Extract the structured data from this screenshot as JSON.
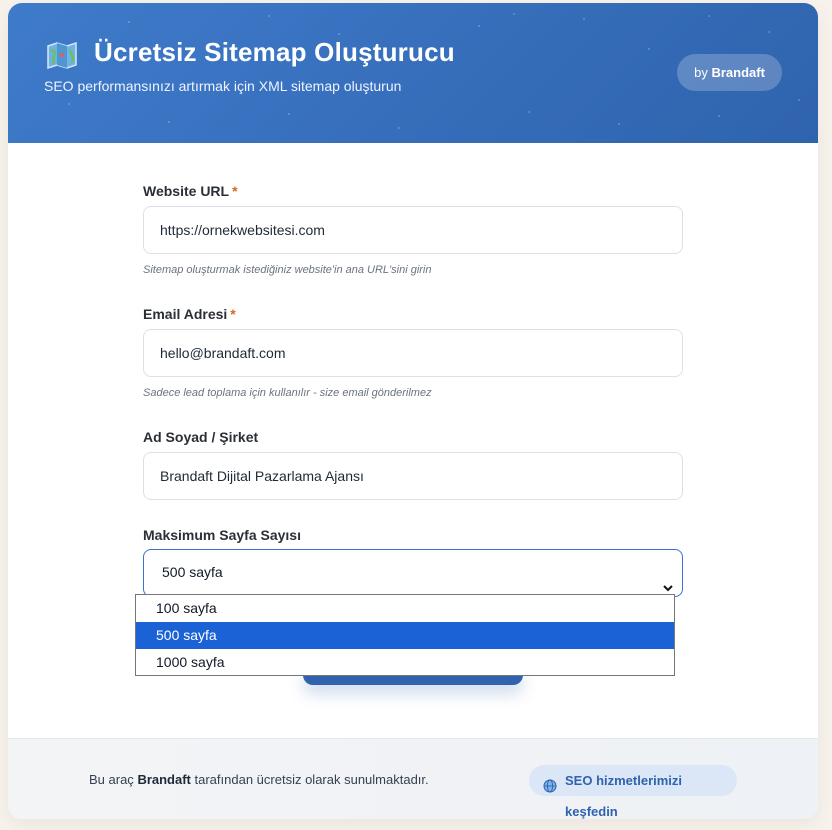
{
  "header": {
    "icon": "map-icon",
    "title": "Ücretsiz Sitemap Oluşturucu",
    "subtitle": "SEO performansınızı artırmak için XML sitemap oluşturun",
    "by_prefix": "by",
    "by_brand": "Brandaft"
  },
  "form": {
    "url": {
      "label": "Website URL",
      "required_mark": "*",
      "value": "https://ornekwebsitesi.com",
      "hint": "Sitemap oluşturmak istediğiniz website'in ana URL'sini girin"
    },
    "email": {
      "label": "Email Adresi",
      "required_mark": "*",
      "value": "hello@brandaft.com",
      "hint": "Sadece lead toplama için kullanılır - size email gönderilmez"
    },
    "name": {
      "label": "Ad Soyad / Şirket",
      "value": "Brandaft Dijital Pazarlama Ajansı"
    },
    "max_pages": {
      "label": "Maksimum Sayfa Sayısı",
      "selected": "500 sayfa",
      "options": [
        "100 sayfa",
        "500 sayfa",
        "1000 sayfa"
      ]
    }
  },
  "footer": {
    "text_prefix": "Bu araç",
    "text_brand": "Brandaft",
    "text_suffix": "tarafından ücretsiz olarak sunulmaktadır.",
    "link_label": "SEO hizmetlerimizi keşfedin",
    "link_icon": "globe-icon"
  },
  "colors": {
    "header_gradient_start": "#3f7bcb",
    "header_gradient_end": "#2f63ad",
    "required": "#d9661f",
    "selected_option": "#1a62d6"
  }
}
